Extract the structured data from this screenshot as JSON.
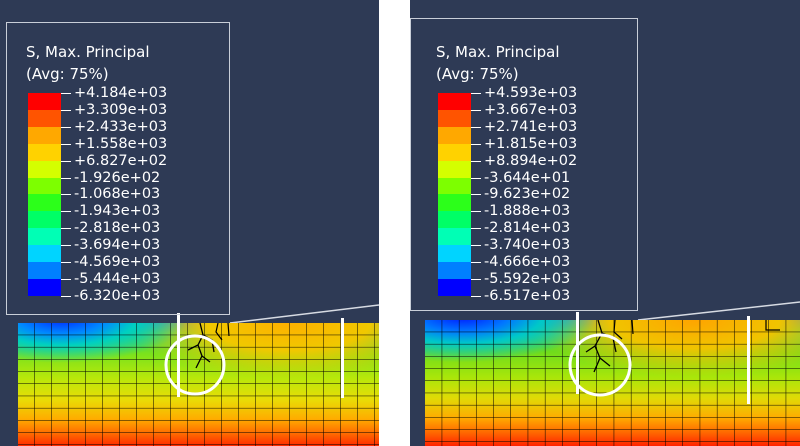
{
  "panels": [
    {
      "id": "left",
      "legend": {
        "title_line1": "S, Max. Principal",
        "title_line2": "(Avg: 75%)",
        "values": [
          "+4.184e+03",
          "+3.309e+03",
          "+2.433e+03",
          "+1.558e+03",
          "+6.827e+02",
          "-1.926e+02",
          "-1.068e+03",
          "-1.943e+03",
          "-2.818e+03",
          "-3.694e+03",
          "-4.569e+03",
          "-5.444e+03",
          "-6.320e+03"
        ]
      }
    },
    {
      "id": "right",
      "legend": {
        "title_line1": "S, Max. Principal",
        "title_line2": "(Avg: 75%)",
        "values": [
          "+4.593e+03",
          "+3.667e+03",
          "+2.741e+03",
          "+1.815e+03",
          "+8.894e+02",
          "-3.644e+01",
          "-9.623e+02",
          "-1.888e+03",
          "-2.814e+03",
          "-3.740e+03",
          "-4.666e+03",
          "-5.592e+03",
          "-6.517e+03"
        ]
      }
    }
  ],
  "colors": {
    "background": "#2e3a55",
    "contour_bands": [
      "#ff0000",
      "#ff5400",
      "#ffa800",
      "#ffd200",
      "#d4ff00",
      "#7dff00",
      "#2cff1a",
      "#00ff66",
      "#00ffb5",
      "#00d4ff",
      "#0080ff",
      "#0000ff"
    ]
  }
}
